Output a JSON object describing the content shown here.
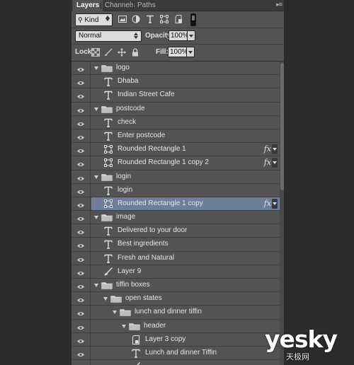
{
  "tabs": [
    "Layers",
    "Channels",
    "Paths"
  ],
  "filter": {
    "kind_label": "Kind"
  },
  "blend": {
    "mode": "Normal",
    "opacity_label": "Opacity:",
    "opacity_value": "100%"
  },
  "lock": {
    "label": "Lock:",
    "fill_label": "Fill:",
    "fill_value": "100%"
  },
  "layers": [
    {
      "name": "logo",
      "type": "group",
      "depth": 0,
      "selected": false,
      "fx": false
    },
    {
      "name": "Dhaba",
      "type": "text",
      "depth": 1,
      "selected": false,
      "fx": false
    },
    {
      "name": "Indian Street Cafe",
      "type": "text",
      "depth": 1,
      "selected": false,
      "fx": false
    },
    {
      "name": "postcode",
      "type": "group",
      "depth": 0,
      "selected": false,
      "fx": false
    },
    {
      "name": "check",
      "type": "text",
      "depth": 1,
      "selected": false,
      "fx": false
    },
    {
      "name": "Enter postcode",
      "type": "text",
      "depth": 1,
      "selected": false,
      "fx": false
    },
    {
      "name": "Rounded Rectangle 1",
      "type": "shape",
      "depth": 1,
      "selected": false,
      "fx": true
    },
    {
      "name": "Rounded Rectangle 1 copy 2",
      "type": "shape",
      "depth": 1,
      "selected": false,
      "fx": true
    },
    {
      "name": "login",
      "type": "group",
      "depth": 0,
      "selected": false,
      "fx": false
    },
    {
      "name": "login",
      "type": "text",
      "depth": 1,
      "selected": false,
      "fx": false
    },
    {
      "name": "Rounded Rectangle 1 copy",
      "type": "shape",
      "depth": 1,
      "selected": true,
      "fx": true
    },
    {
      "name": "image",
      "type": "group",
      "depth": 0,
      "selected": false,
      "fx": false
    },
    {
      "name": "Delivered to your door",
      "type": "text",
      "depth": 1,
      "selected": false,
      "fx": false
    },
    {
      "name": "Best ingredients",
      "type": "text",
      "depth": 1,
      "selected": false,
      "fx": false
    },
    {
      "name": "Fresh and Natural",
      "type": "text",
      "depth": 1,
      "selected": false,
      "fx": false
    },
    {
      "name": "Layer 9",
      "type": "brush",
      "depth": 1,
      "selected": false,
      "fx": false
    },
    {
      "name": "tiffin boxes",
      "type": "group",
      "depth": 0,
      "selected": false,
      "fx": false
    },
    {
      "name": "open states",
      "type": "group",
      "depth": 1,
      "selected": false,
      "fx": false
    },
    {
      "name": "lunch and dinner tiffin",
      "type": "group",
      "depth": 2,
      "selected": false,
      "fx": false
    },
    {
      "name": "header",
      "type": "group",
      "depth": 3,
      "selected": false,
      "fx": false
    },
    {
      "name": "Layer 3 copy",
      "type": "smart",
      "depth": 4,
      "selected": false,
      "fx": false
    },
    {
      "name": "Lunch and dinner Tiffin",
      "type": "text",
      "depth": 4,
      "selected": false,
      "fx": false
    },
    {
      "name": "",
      "type": "brush",
      "depth": 4,
      "selected": false,
      "fx": false
    }
  ],
  "fx_label": "fx",
  "watermark": {
    "logo": "yesky",
    "sub": "天极网"
  },
  "colors": {
    "panel_bg": "#535353",
    "selected_row": "#6d7f9b",
    "tabbar_bg": "#3a3a3a"
  }
}
